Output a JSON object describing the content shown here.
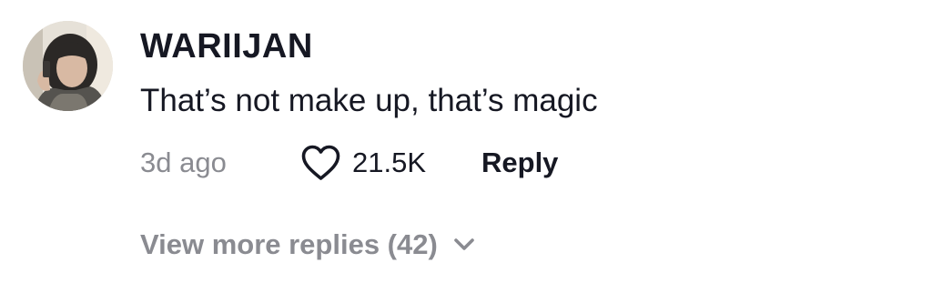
{
  "comment": {
    "username": "WARIIJAN",
    "text": "That’s not make up, that’s magic",
    "timestamp": "3d ago",
    "likes": "21.5K",
    "reply_label": "Reply",
    "view_replies_label": "View more replies (42)"
  },
  "icons": {
    "like": "heart-outline-icon",
    "expand": "chevron-down-icon"
  },
  "colors": {
    "primary_text": "#161823",
    "secondary_text": "#8a8b91",
    "background": "#ffffff"
  }
}
